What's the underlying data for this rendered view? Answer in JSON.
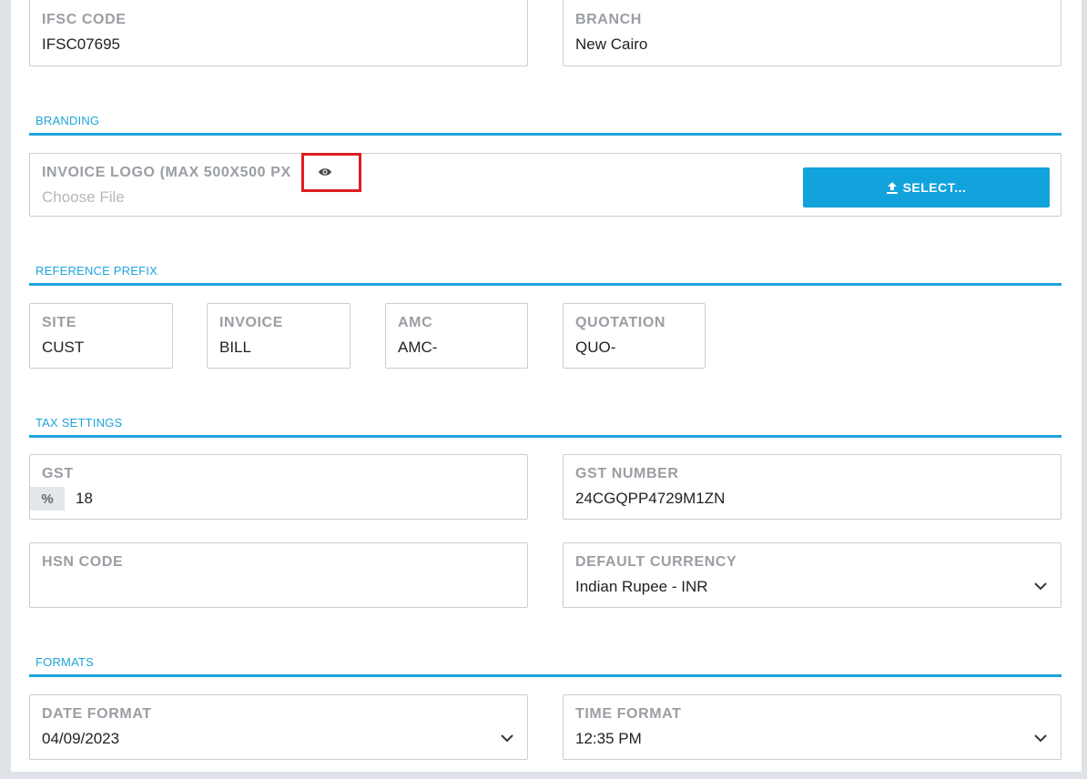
{
  "bank": {
    "ifsc": {
      "label": "IFSC CODE",
      "value": "IFSC07695"
    },
    "branch": {
      "label": "BRANCH",
      "value": "New Cairo"
    }
  },
  "branding": {
    "title": "BRANDING",
    "logo": {
      "label": "INVOICE LOGO (MAX 500X500 PX",
      "placeholder": "Choose File",
      "preview_icon": "eye-icon"
    },
    "select_button": {
      "label": "SELECT...",
      "icon": "upload-icon"
    }
  },
  "reference_prefix": {
    "title": "REFERENCE PREFIX",
    "fields": [
      {
        "label": "SITE",
        "value": "CUST"
      },
      {
        "label": "INVOICE",
        "value": "BILL"
      },
      {
        "label": "AMC",
        "value": "AMC-"
      },
      {
        "label": "QUOTATION",
        "value": "QUO-"
      }
    ]
  },
  "tax": {
    "title": "TAX SETTINGS",
    "gst": {
      "label": "GST",
      "addon": "%",
      "value": "18"
    },
    "gst_number": {
      "label": "GST NUMBER",
      "value": "24CGQPP4729M1ZN"
    },
    "hsn": {
      "label": "HSN CODE",
      "value": ""
    },
    "currency": {
      "label": "DEFAULT CURRENCY",
      "value": "Indian Rupee - INR"
    }
  },
  "formats": {
    "title": "FORMATS",
    "date": {
      "label": "DATE FORMAT",
      "value": "04/09/2023"
    },
    "time": {
      "label": "TIME FORMAT",
      "value": "12:35 PM"
    }
  },
  "colors": {
    "accent": "#1ea5d9",
    "button": "#12a3dc",
    "highlight": "#e11b22"
  }
}
